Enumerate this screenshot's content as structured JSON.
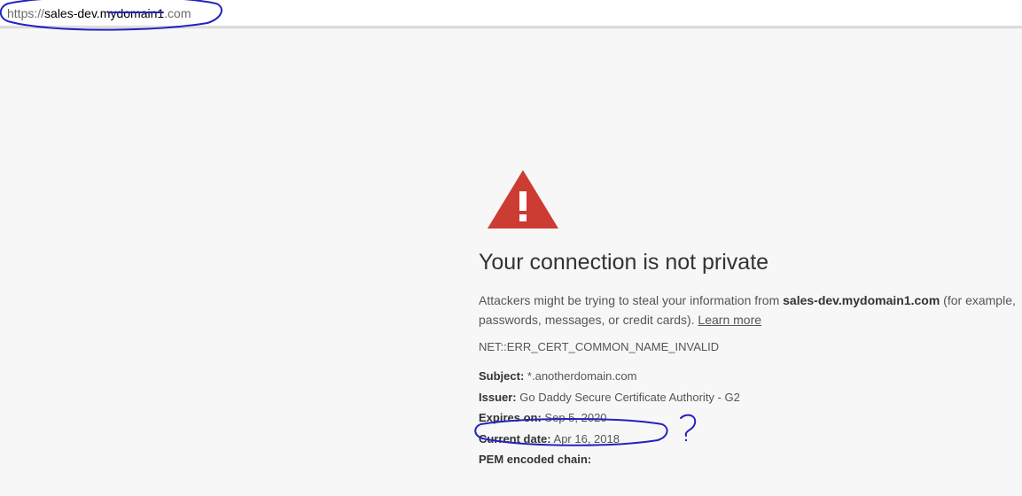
{
  "address_bar": {
    "scheme": "https://",
    "host": "sales-dev.mydomain1",
    "tld": ".com"
  },
  "error": {
    "title": "Your connection is not private",
    "body_prefix": "Attackers might be trying to steal your information from ",
    "domain_bold": "sales-dev.mydomain1.com",
    "body_suffix": " (for example, passwords, messages, or credit cards). ",
    "learn_more": "Learn more",
    "code": "NET::ERR_CERT_COMMON_NAME_INVALID"
  },
  "cert": {
    "subject_label": "Subject:",
    "subject_value": "*.anotherdomain.com",
    "issuer_label": "Issuer:",
    "issuer_value": "Go Daddy Secure Certificate Authority - G2",
    "expires_label": "Expires on:",
    "expires_value": "Sep 5, 2020",
    "current_label": "Current date:",
    "current_value": "Apr 16, 2018",
    "pem_label": "PEM encoded chain:"
  },
  "annotations": {
    "question_mark": "?"
  }
}
